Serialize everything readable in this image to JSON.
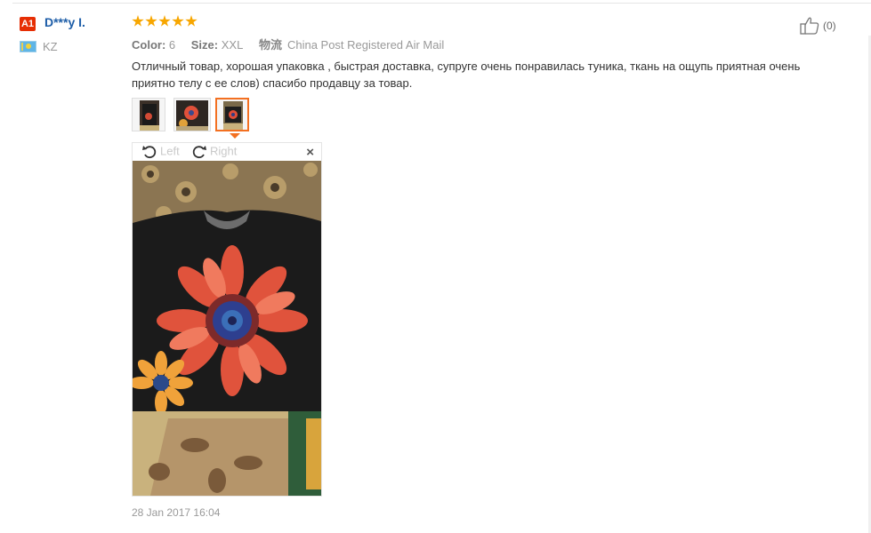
{
  "user": {
    "level": "A1",
    "name": "D***y I.",
    "country": "KZ"
  },
  "review": {
    "rating": 5,
    "color_label": "Color:",
    "color_value": "6",
    "size_label": "Size:",
    "size_value": "XXL",
    "shipping_label": "物流",
    "shipping_value": "China Post Registered Air Mail",
    "text": "Отличный товар, хорошая упаковка , быстрая доставка, супруге очень понравилась туника, ткань на ощупь приятная очень приятно телу с ее слов) спасибо продавцу за товар.",
    "date": "28 Jan 2017 16:04"
  },
  "viewer": {
    "rotate_left": "Left",
    "rotate_right": "Right",
    "close": "×"
  },
  "helpful": {
    "count": "(0)"
  },
  "colors": {
    "accent": "#f37021",
    "star": "#f7a600",
    "link": "#1e5ea8",
    "badge": "#e62e04"
  }
}
